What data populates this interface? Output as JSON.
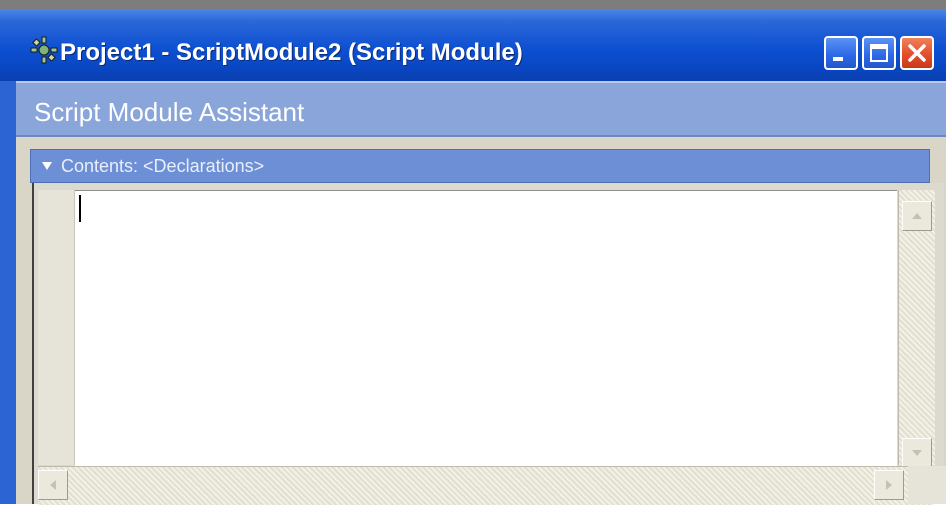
{
  "window": {
    "title": "Project1 - ScriptModule2 (Script Module)",
    "icon": "script-module-icon",
    "controls": {
      "minimize": "minimize-icon",
      "maximize": "maximize-icon",
      "close": "close-icon"
    },
    "colors": {
      "titlebar": "#0d50d2",
      "close_button": "#e24f2a",
      "assistant_header": "#8aa5d9",
      "contents_bar": "#6c8fd6"
    }
  },
  "assistant": {
    "title": "Script Module Assistant"
  },
  "contents": {
    "label": "Contents: <Declarations>",
    "toggle_icon": "triangle-down-icon"
  },
  "editor": {
    "text": ""
  }
}
